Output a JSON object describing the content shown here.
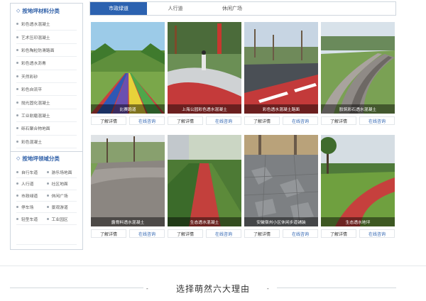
{
  "sidebar": {
    "material_heading": "按地坪材料分类",
    "materials": [
      "彩色透水混凝土",
      "艺术压印混凝土",
      "彩色陶粒防滑路面",
      "彩色透水沥青",
      "天然彩砂",
      "彩色自流平",
      "抛光固化混凝土",
      "工业耐磨混凝土",
      "砾石聚合物地面",
      "彩色混凝土"
    ],
    "field_heading": "按地坪领域分类",
    "fields": [
      "自行车道",
      "游乐场地面",
      "人行道",
      "社区地面",
      "市政绿道",
      "休闲广场",
      "停车场",
      "景观游道",
      "轻型车道",
      "工业园区"
    ]
  },
  "tabs": [
    "市政绿道",
    "人行道",
    "休闲广场"
  ],
  "cards": [
    {
      "caption": "比赛跑道",
      "detail": "了解详情",
      "consult": "在线咨询"
    },
    {
      "caption": "上海公园彩色透水混凝土",
      "detail": "了解详情",
      "consult": "在线咨询"
    },
    {
      "caption": "彩色透水混凝土路面",
      "detail": "了解详情",
      "consult": "在线咨询"
    },
    {
      "caption": "胶筑彩石透水混凝土",
      "detail": "了解详情",
      "consult": "在线咨询"
    },
    {
      "caption": "露骨料透水混凝土",
      "detail": "了解详情",
      "consult": "在线咨询"
    },
    {
      "caption": "生态透水混凝土",
      "detail": "了解详情",
      "consult": "在线咨询"
    },
    {
      "caption": "安徽宿州小区休闲步道铺装",
      "detail": "了解详情",
      "consult": "在线咨询"
    },
    {
      "caption": "生态透水地坪",
      "detail": "了解详情",
      "consult": "在线咨询"
    }
  ],
  "section": {
    "title": "选择萌然六大理由",
    "dash_left": "-",
    "dash_right": "-"
  },
  "colors": {
    "accent": "#2c62b0",
    "heading": "#2d5ea7"
  }
}
